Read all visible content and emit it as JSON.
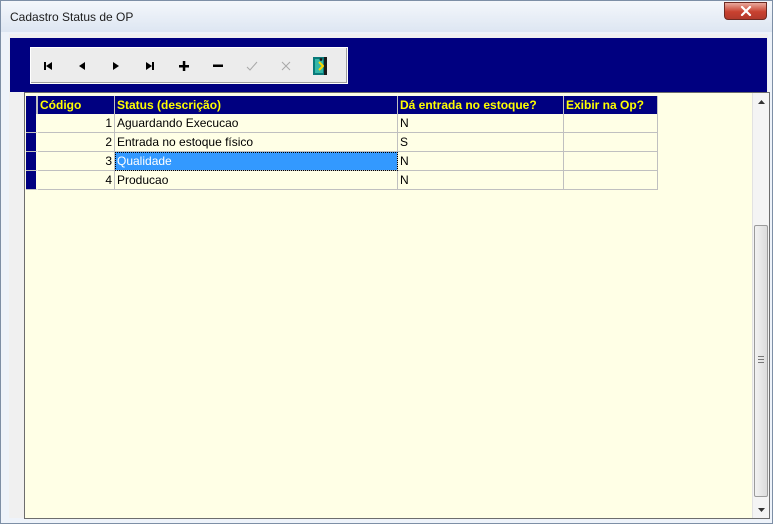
{
  "window": {
    "title": "Cadastro Status de OP"
  },
  "navigator": {
    "buttons": [
      {
        "icon": "first-record-icon"
      },
      {
        "icon": "prior-record-icon"
      },
      {
        "icon": "next-record-icon"
      },
      {
        "icon": "last-record-icon"
      },
      {
        "icon": "insert-record-icon"
      },
      {
        "icon": "delete-record-icon"
      },
      {
        "icon": "post-edit-icon"
      },
      {
        "icon": "cancel-edit-icon"
      },
      {
        "icon": "exit-door-icon"
      }
    ]
  },
  "grid": {
    "columns": [
      "Código",
      "Status (descrição)",
      "Dá entrada no estoque?",
      "Exibir na Op?"
    ],
    "rows": [
      {
        "codigo": "1",
        "status": "Aguardando Execucao",
        "estoque": "N",
        "exibir": ""
      },
      {
        "codigo": "2",
        "status": "Entrada no estoque físico",
        "estoque": "S",
        "exibir": ""
      },
      {
        "codigo": "3",
        "status": "Qualidade",
        "estoque": "N",
        "exibir": ""
      },
      {
        "codigo": "4",
        "status": "Producao",
        "estoque": "N",
        "exibir": ""
      }
    ],
    "selected_row": 2
  },
  "colors": {
    "header_bg": "#000080",
    "header_text": "#ffff00",
    "grid_bg": "#ffffe6",
    "selection": "#3399ff"
  }
}
